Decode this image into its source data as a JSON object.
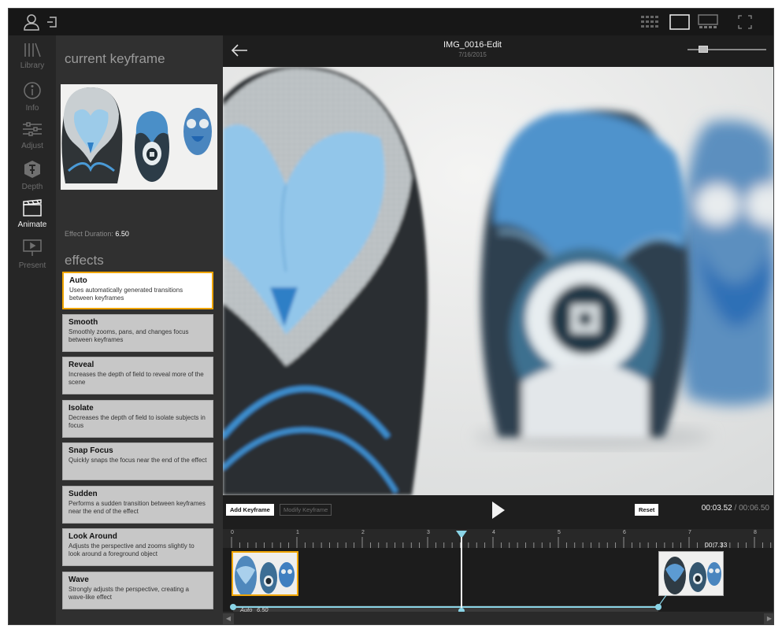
{
  "app": {
    "nav": [
      {
        "label": "Library",
        "icon": "library-icon",
        "active": false
      },
      {
        "label": "Info",
        "icon": "info-icon",
        "active": false
      },
      {
        "label": "Adjust",
        "icon": "sliders-icon",
        "active": false
      },
      {
        "label": "Depth",
        "icon": "depth-icon",
        "active": false
      },
      {
        "label": "Animate",
        "icon": "clapperboard-icon",
        "active": true
      },
      {
        "label": "Present",
        "icon": "present-icon",
        "active": false
      }
    ]
  },
  "panel": {
    "title": "current keyframe",
    "duration_label": "Effect Duration:",
    "duration_value": "6.50",
    "effects_title": "effects",
    "effects": [
      {
        "name": "Auto",
        "desc": "Uses automatically generated transitions between keyframes"
      },
      {
        "name": "Smooth",
        "desc": "Smoothly zooms, pans, and changes focus between keyframes"
      },
      {
        "name": "Reveal",
        "desc": "Increases the depth of field to reveal more of the scene"
      },
      {
        "name": "Isolate",
        "desc": "Decreases the depth of field to isolate subjects in focus"
      },
      {
        "name": "Snap Focus",
        "desc": "Quickly snaps the focus near the end of the effect"
      },
      {
        "name": "Sudden",
        "desc": "Performs a sudden transition between keyframes near the end of the effect"
      },
      {
        "name": "Look Around",
        "desc": "Adjusts the perspective and zooms slightly to look around a foreground object"
      },
      {
        "name": "Wave",
        "desc": "Strongly adjusts the perspective, creating a wave-like effect"
      }
    ],
    "selected_effect": "Auto"
  },
  "header": {
    "title": "IMG_0016-Edit",
    "date": "7/16/2015",
    "zoom_level": 0.2
  },
  "controls": {
    "add_keyframe": "Add Keyframe",
    "modify_keyframe": "Modify Keyframe",
    "reset": "Reset",
    "current_time": "00:03.52",
    "separator": " / ",
    "total_time": "00:06.50"
  },
  "timeline": {
    "ruler_labels": [
      "0",
      "1",
      "2",
      "3",
      "4",
      "5",
      "6",
      "7",
      "8"
    ],
    "playhead_seconds": 3.52,
    "end_keyframe_time": "00:7.33",
    "segment_effect": "Auto",
    "segment_duration": "6.50"
  },
  "colors": {
    "accent_selection": "#f0a500",
    "playhead": "#8ad4e6",
    "owl_blue": "#4a8fc8"
  }
}
